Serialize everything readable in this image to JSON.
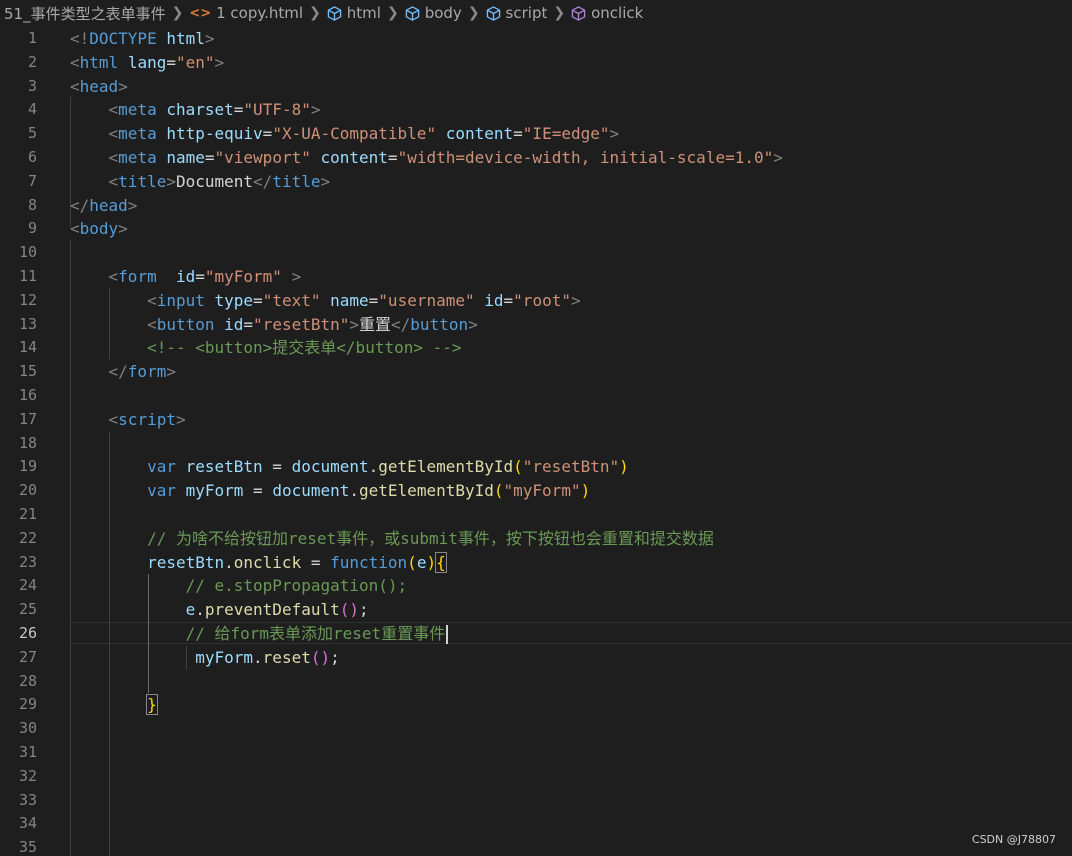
{
  "breadcrumb": {
    "folder": "51_事件类型之表单事件",
    "file": "1 copy.html",
    "symbols": [
      "html",
      "body",
      "script",
      "onclick"
    ]
  },
  "editor": {
    "active_line": 26,
    "line_numbers": [
      "1",
      "2",
      "3",
      "4",
      "5",
      "6",
      "7",
      "8",
      "9",
      "10",
      "11",
      "12",
      "13",
      "14",
      "15",
      "16",
      "17",
      "18",
      "19",
      "20",
      "21",
      "22",
      "23",
      "24",
      "25",
      "26",
      "27",
      "28",
      "29",
      "30",
      "31",
      "32",
      "33",
      "34",
      "35"
    ],
    "lines": [
      [
        [
          "t-punct",
          "<!"
        ],
        [
          "t-tag",
          "DOCTYPE"
        ],
        [
          "t-text",
          " "
        ],
        [
          "t-attr",
          "html"
        ],
        [
          "t-punct",
          ">"
        ]
      ],
      [
        [
          "t-punct",
          "<"
        ],
        [
          "t-tag",
          "html"
        ],
        [
          "t-text",
          " "
        ],
        [
          "t-attr",
          "lang"
        ],
        [
          "t-text",
          "="
        ],
        [
          "t-str",
          "\"en\""
        ],
        [
          "t-punct",
          ">"
        ]
      ],
      [
        [
          "t-punct",
          "<"
        ],
        [
          "t-tag",
          "head"
        ],
        [
          "t-punct",
          ">"
        ]
      ],
      [
        [
          "t-text",
          "    "
        ],
        [
          "t-punct",
          "<"
        ],
        [
          "t-tag",
          "meta"
        ],
        [
          "t-text",
          " "
        ],
        [
          "t-attr",
          "charset"
        ],
        [
          "t-text",
          "="
        ],
        [
          "t-str",
          "\"UTF-8\""
        ],
        [
          "t-punct",
          ">"
        ]
      ],
      [
        [
          "t-text",
          "    "
        ],
        [
          "t-punct",
          "<"
        ],
        [
          "t-tag",
          "meta"
        ],
        [
          "t-text",
          " "
        ],
        [
          "t-attr",
          "http-equiv"
        ],
        [
          "t-text",
          "="
        ],
        [
          "t-str",
          "\"X-UA-Compatible\""
        ],
        [
          "t-text",
          " "
        ],
        [
          "t-attr",
          "content"
        ],
        [
          "t-text",
          "="
        ],
        [
          "t-str",
          "\"IE=edge\""
        ],
        [
          "t-punct",
          ">"
        ]
      ],
      [
        [
          "t-text",
          "    "
        ],
        [
          "t-punct",
          "<"
        ],
        [
          "t-tag",
          "meta"
        ],
        [
          "t-text",
          " "
        ],
        [
          "t-attr",
          "name"
        ],
        [
          "t-text",
          "="
        ],
        [
          "t-str",
          "\"viewport\""
        ],
        [
          "t-text",
          " "
        ],
        [
          "t-attr",
          "content"
        ],
        [
          "t-text",
          "="
        ],
        [
          "t-str",
          "\"width=device-width, initial-scale=1.0\""
        ],
        [
          "t-punct",
          ">"
        ]
      ],
      [
        [
          "t-text",
          "    "
        ],
        [
          "t-punct",
          "<"
        ],
        [
          "t-tag",
          "title"
        ],
        [
          "t-punct",
          ">"
        ],
        [
          "t-text",
          "Document"
        ],
        [
          "t-punct",
          "</"
        ],
        [
          "t-tag",
          "title"
        ],
        [
          "t-punct",
          ">"
        ]
      ],
      [
        [
          "t-punct",
          "</"
        ],
        [
          "t-tag",
          "head"
        ],
        [
          "t-punct",
          ">"
        ]
      ],
      [
        [
          "t-punct",
          "<"
        ],
        [
          "t-tag",
          "body"
        ],
        [
          "t-punct",
          ">"
        ]
      ],
      [],
      [
        [
          "t-text",
          "    "
        ],
        [
          "t-punct",
          "<"
        ],
        [
          "t-tag",
          "form"
        ],
        [
          "t-text",
          "  "
        ],
        [
          "t-attr",
          "id"
        ],
        [
          "t-text",
          "="
        ],
        [
          "t-str",
          "\"myForm\""
        ],
        [
          "t-text",
          " "
        ],
        [
          "t-punct",
          ">"
        ]
      ],
      [
        [
          "t-text",
          "        "
        ],
        [
          "t-punct",
          "<"
        ],
        [
          "t-tag",
          "input"
        ],
        [
          "t-text",
          " "
        ],
        [
          "t-attr",
          "type"
        ],
        [
          "t-text",
          "="
        ],
        [
          "t-str",
          "\"text\""
        ],
        [
          "t-text",
          " "
        ],
        [
          "t-attr",
          "name"
        ],
        [
          "t-text",
          "="
        ],
        [
          "t-str",
          "\"username\""
        ],
        [
          "t-text",
          " "
        ],
        [
          "t-attr",
          "id"
        ],
        [
          "t-text",
          "="
        ],
        [
          "t-str",
          "\"root\""
        ],
        [
          "t-punct",
          ">"
        ]
      ],
      [
        [
          "t-text",
          "        "
        ],
        [
          "t-punct",
          "<"
        ],
        [
          "t-tag",
          "button"
        ],
        [
          "t-text",
          " "
        ],
        [
          "t-attr",
          "id"
        ],
        [
          "t-text",
          "="
        ],
        [
          "t-str",
          "\"resetBtn\""
        ],
        [
          "t-punct",
          ">"
        ],
        [
          "t-text",
          "重置"
        ],
        [
          "t-punct",
          "</"
        ],
        [
          "t-tag",
          "button"
        ],
        [
          "t-punct",
          ">"
        ]
      ],
      [
        [
          "t-text",
          "        "
        ],
        [
          "t-comment",
          "<!-- <button>提交表单</button> -->"
        ]
      ],
      [
        [
          "t-text",
          "    "
        ],
        [
          "t-punct",
          "</"
        ],
        [
          "t-tag",
          "form"
        ],
        [
          "t-punct",
          ">"
        ]
      ],
      [],
      [
        [
          "t-text",
          "    "
        ],
        [
          "t-punct",
          "<"
        ],
        [
          "t-tag",
          "script"
        ],
        [
          "t-punct",
          ">"
        ]
      ],
      [],
      [
        [
          "t-text",
          "        "
        ],
        [
          "t-kw",
          "var"
        ],
        [
          "t-text",
          " "
        ],
        [
          "t-var",
          "resetBtn"
        ],
        [
          "t-op",
          " = "
        ],
        [
          "t-var",
          "document"
        ],
        [
          "t-op",
          "."
        ],
        [
          "t-fn",
          "getElementById"
        ],
        [
          "t-br1",
          "("
        ],
        [
          "t-str",
          "\"resetBtn\""
        ],
        [
          "t-br1",
          ")"
        ]
      ],
      [
        [
          "t-text",
          "        "
        ],
        [
          "t-kw",
          "var"
        ],
        [
          "t-text",
          " "
        ],
        [
          "t-var",
          "myForm"
        ],
        [
          "t-op",
          " = "
        ],
        [
          "t-var",
          "document"
        ],
        [
          "t-op",
          "."
        ],
        [
          "t-fn",
          "getElementById"
        ],
        [
          "t-br1",
          "("
        ],
        [
          "t-str",
          "\"myForm\""
        ],
        [
          "t-br1",
          ")"
        ]
      ],
      [],
      [
        [
          "t-text",
          "        "
        ],
        [
          "t-comment",
          "// 为啥不给按钮加reset事件，或submit事件，按下按钮也会重置和提交数据"
        ]
      ],
      [
        [
          "t-text",
          "        "
        ],
        [
          "t-var",
          "resetBtn"
        ],
        [
          "t-op",
          "."
        ],
        [
          "t-fn",
          "onclick"
        ],
        [
          "t-op",
          " = "
        ],
        [
          "t-kw",
          "function"
        ],
        [
          "t-br1",
          "("
        ],
        [
          "t-var",
          "e"
        ],
        [
          "t-br1",
          ")"
        ],
        [
          "t-br1 t-match",
          "{"
        ]
      ],
      [
        [
          "t-text",
          "            "
        ],
        [
          "t-comment",
          "// e.stopPropagation();"
        ]
      ],
      [
        [
          "t-text",
          "            "
        ],
        [
          "t-var",
          "e"
        ],
        [
          "t-op",
          "."
        ],
        [
          "t-fn",
          "preventDefault"
        ],
        [
          "t-br2",
          "()"
        ],
        [
          "t-op",
          ";"
        ]
      ],
      [
        [
          "t-text",
          "            "
        ],
        [
          "t-comment",
          "// 给form表单添加reset重置事件"
        ]
      ],
      [
        [
          "t-text",
          "             "
        ],
        [
          "t-var",
          "myForm"
        ],
        [
          "t-op",
          "."
        ],
        [
          "t-fn",
          "reset"
        ],
        [
          "t-br2",
          "()"
        ],
        [
          "t-op",
          ";"
        ]
      ],
      [],
      [
        [
          "t-text",
          "        "
        ],
        [
          "t-br1 t-match",
          "}"
        ]
      ],
      [],
      [],
      [],
      [],
      [],
      []
    ]
  },
  "watermark": "CSDN @J78807"
}
